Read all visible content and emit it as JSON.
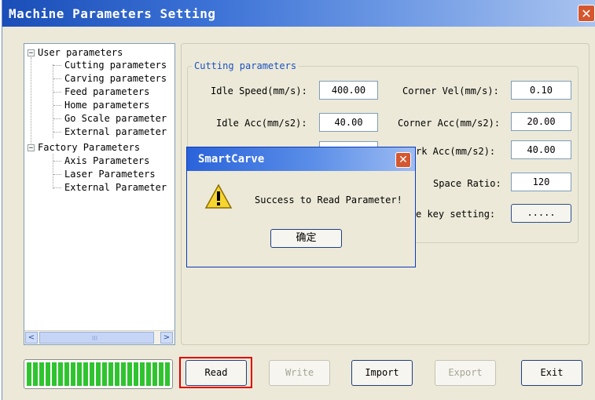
{
  "window": {
    "title": "Machine Parameters Setting",
    "close_glyph": "✕"
  },
  "tree": {
    "groups": [
      {
        "label": "User parameters",
        "expander": "−",
        "children": [
          "Cutting parameters",
          "Carving parameters",
          "Feed parameters",
          "Home parameters",
          "Go Scale parameter",
          "External parameter"
        ]
      },
      {
        "label": "Factory Parameters",
        "expander": "−",
        "children": [
          "Axis Parameters",
          "Laser Parameters",
          "External Parameter"
        ]
      }
    ],
    "scroll_left": "<",
    "scroll_right": ">",
    "thumb_grip": "III"
  },
  "cutting": {
    "group_title": "Cutting parameters",
    "idle_speed_label": "Idle Speed(mm/s):",
    "idle_speed_value": "400.00",
    "idle_acc_label": "Idle Acc(mm/s2):",
    "idle_acc_value": "40.00",
    "corner_vel_label": "Corner Vel(mm/s):",
    "corner_vel_value": "0.10",
    "corner_acc_label": "Corner Acc(mm/s2):",
    "corner_acc_value": "20.00",
    "work_acc_label_partial": "rk Acc(mm/s2):",
    "work_acc_value": "40.00",
    "space_ratio_label": "Space Ratio:",
    "space_ratio_value": "120",
    "key_setting_label_partial": "e key setting:",
    "key_setting_button": "....."
  },
  "buttons": {
    "read": "Read",
    "write": "Write",
    "import": "Import",
    "export": "Export",
    "exit": "Exit"
  },
  "progress": {
    "fraction": 1.0,
    "color": "#2fc42f"
  },
  "dialog": {
    "title": "SmartCarve",
    "message": "Success to Read Parameter!",
    "ok": "确定",
    "close_glyph": "✕",
    "icon": "warning-icon"
  },
  "colors": {
    "title_bar": "#1a4eb8",
    "group_title": "#1a52c4",
    "highlight": "#e00000"
  }
}
